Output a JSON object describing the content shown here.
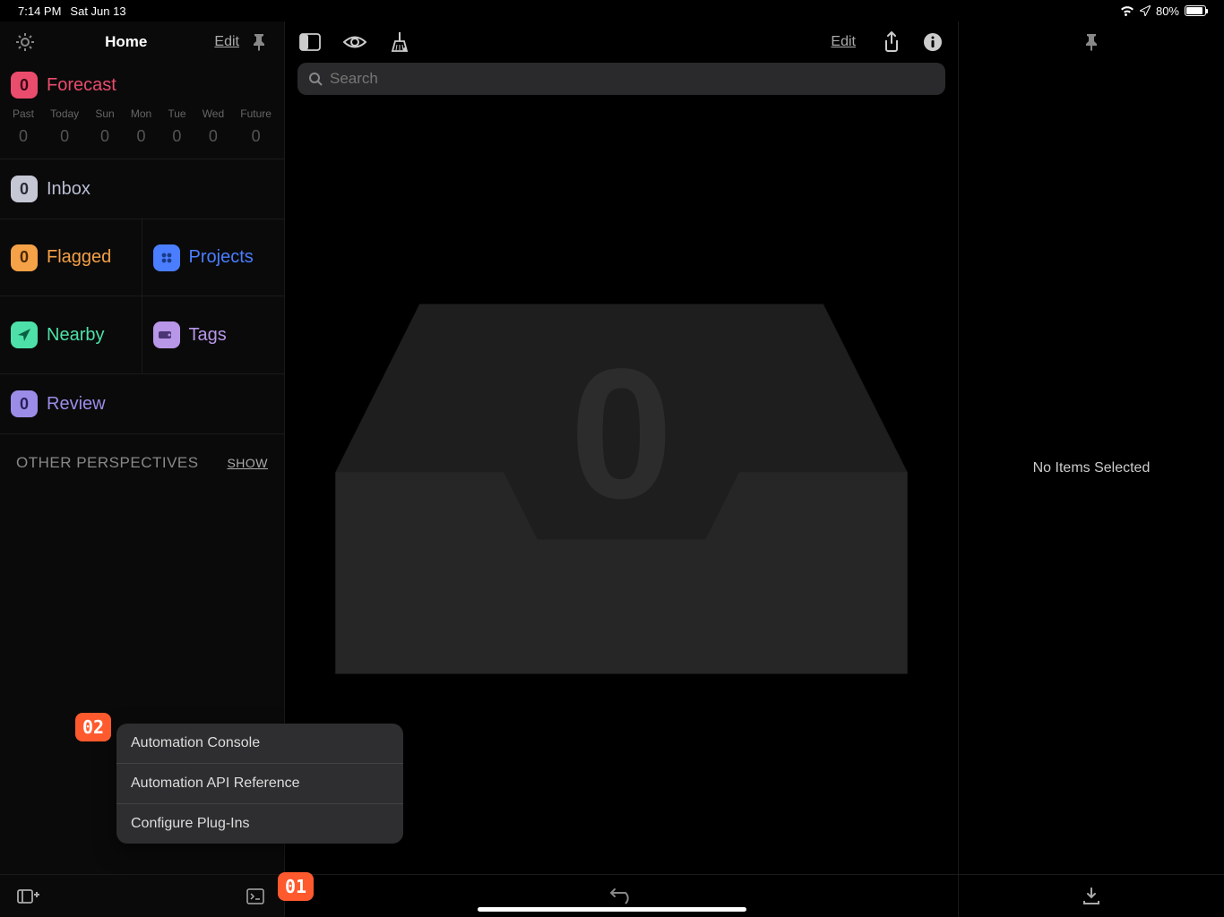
{
  "status_bar": {
    "time": "7:14 PM",
    "date": "Sat Jun 13",
    "battery": "80%"
  },
  "sidebar": {
    "title": "Home",
    "edit": "Edit",
    "forecast": {
      "badge": "0",
      "label": "Forecast",
      "days": [
        {
          "name": "Past",
          "count": "0"
        },
        {
          "name": "Today",
          "count": "0"
        },
        {
          "name": "Sun",
          "count": "0"
        },
        {
          "name": "Mon",
          "count": "0"
        },
        {
          "name": "Tue",
          "count": "0"
        },
        {
          "name": "Wed",
          "count": "0"
        },
        {
          "name": "Future",
          "count": "0"
        }
      ]
    },
    "inbox": {
      "badge": "0",
      "label": "Inbox"
    },
    "flagged": {
      "badge": "0",
      "label": "Flagged"
    },
    "projects": {
      "label": "Projects"
    },
    "nearby": {
      "label": "Nearby"
    },
    "tags": {
      "label": "Tags"
    },
    "review": {
      "badge": "0",
      "label": "Review"
    },
    "other_label": "OTHER PERSPECTIVES",
    "show_label": "SHOW"
  },
  "middle": {
    "edit": "Edit",
    "search_placeholder": "Search",
    "empty_count": "0"
  },
  "right": {
    "no_items": "No Items Selected"
  },
  "popup": {
    "items": [
      "Automation Console",
      "Automation API Reference",
      "Configure Plug-Ins"
    ]
  },
  "markers": {
    "m1": "01",
    "m2": "02"
  }
}
